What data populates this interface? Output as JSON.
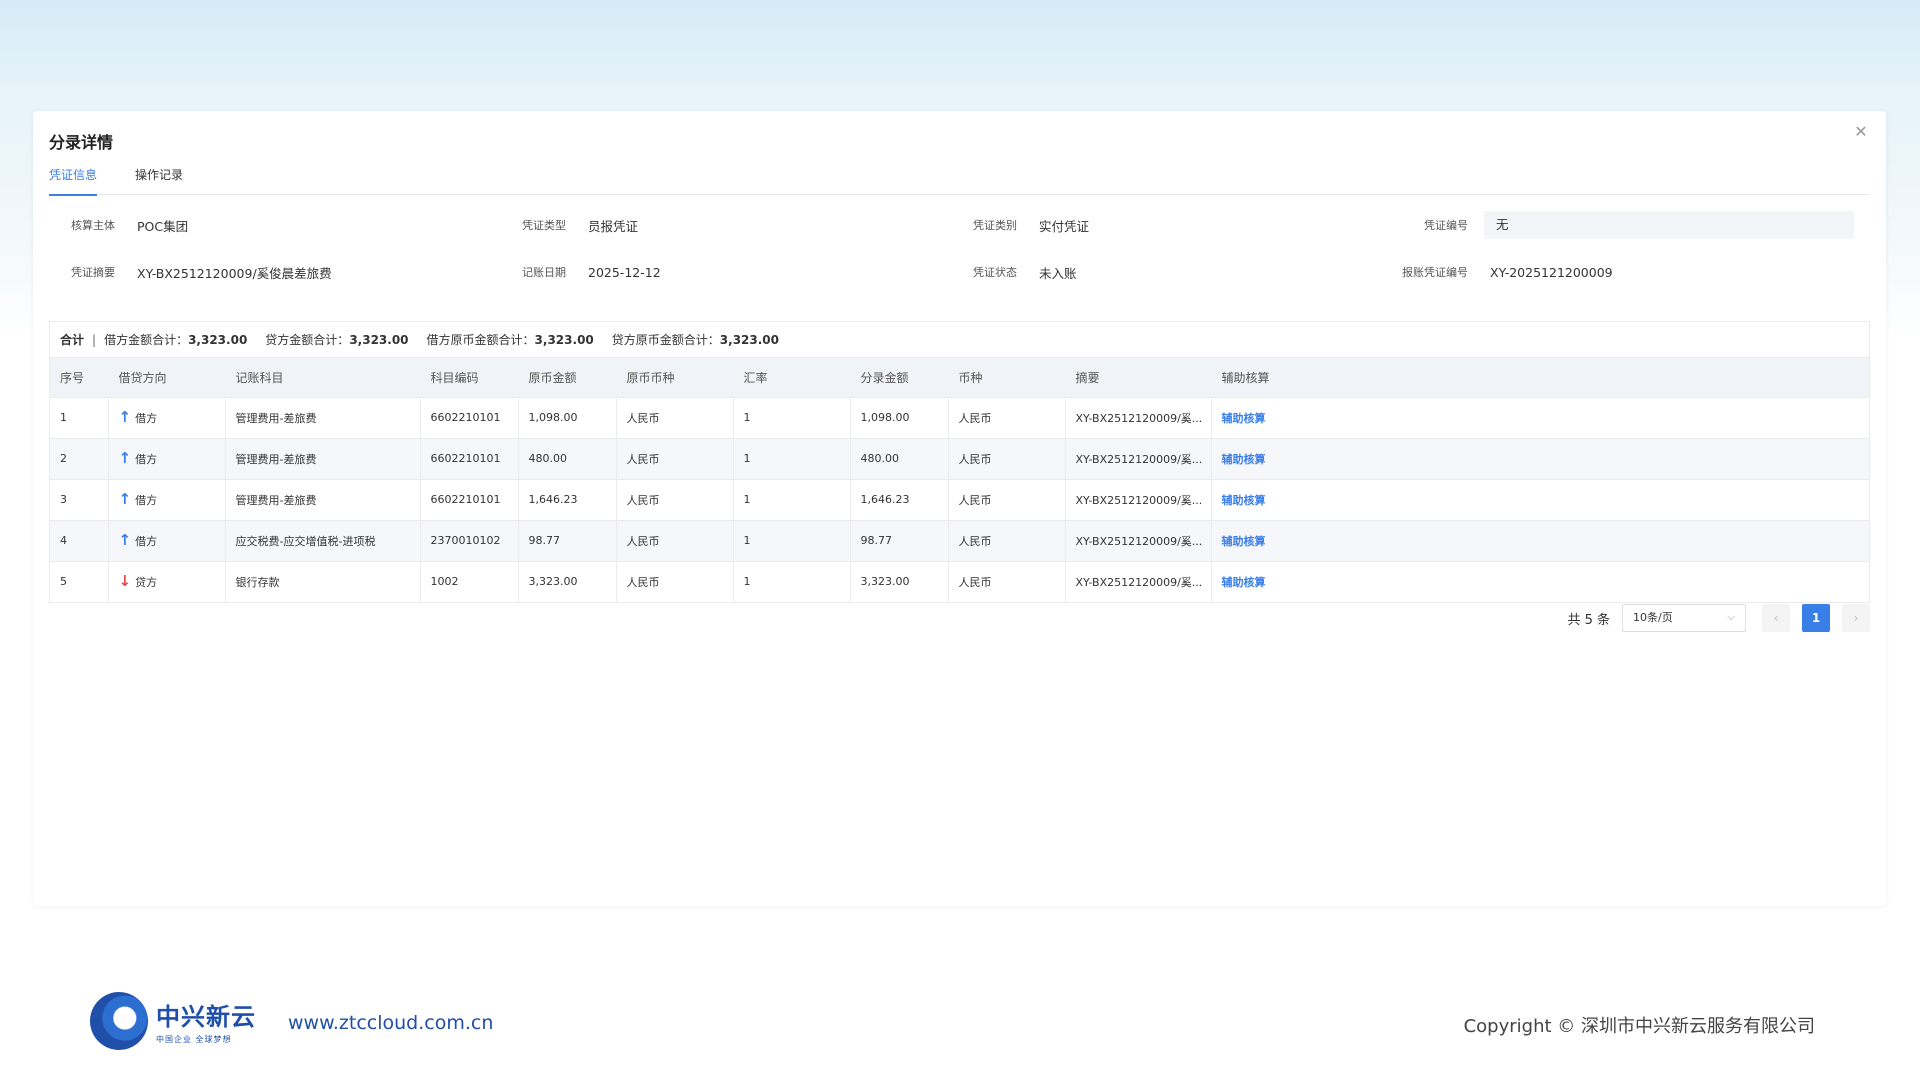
{
  "modal": {
    "title": "分录详情",
    "close_icon": "close-icon",
    "tabs": [
      {
        "label": "凭证信息",
        "active": true
      },
      {
        "label": "操作记录",
        "active": false
      }
    ]
  },
  "info": {
    "row1": [
      {
        "label": "核算主体",
        "value": "POC集团"
      },
      {
        "label": "凭证类型",
        "value": "员报凭证"
      },
      {
        "label": "凭证类别",
        "value": "实付凭证"
      },
      {
        "label": "凭证编号",
        "value": "无"
      }
    ],
    "row2": [
      {
        "label": "凭证摘要",
        "value": "XY-BX2512120009/奚俊晨差旅费"
      },
      {
        "label": "记账日期",
        "value": "2025-12-12"
      },
      {
        "label": "凭证状态",
        "value": "未入账"
      },
      {
        "label": "报账凭证编号",
        "value": "XY-2025121200009"
      }
    ]
  },
  "summary": {
    "label": "合计",
    "separator": "|",
    "items": [
      {
        "label": "借方金额合计：",
        "value": "3,323.00"
      },
      {
        "label": "贷方金额合计：",
        "value": "3,323.00"
      },
      {
        "label": "借方原币金额合计：",
        "value": "3,323.00"
      },
      {
        "label": "贷方原币金额合计：",
        "value": "3,323.00"
      }
    ]
  },
  "table": {
    "columns": [
      "序号",
      "借贷方向",
      "记账科目",
      "科目编码",
      "原币金额",
      "原币币种",
      "汇率",
      "分录金额",
      "币种",
      "摘要",
      "辅助核算"
    ],
    "rows": [
      {
        "no": "1",
        "direction": "借方",
        "dir_type": "up",
        "account": "管理费用-差旅费",
        "code": "6602210101",
        "orig_amount": "1,098.00",
        "orig_currency": "人民币",
        "rate": "1",
        "amount": "1,098.00",
        "currency": "人民币",
        "summary": "XY-BX2512120009/奚...",
        "aux": "辅助核算"
      },
      {
        "no": "2",
        "direction": "借方",
        "dir_type": "up",
        "account": "管理费用-差旅费",
        "code": "6602210101",
        "orig_amount": "480.00",
        "orig_currency": "人民币",
        "rate": "1",
        "amount": "480.00",
        "currency": "人民币",
        "summary": "XY-BX2512120009/奚...",
        "aux": "辅助核算"
      },
      {
        "no": "3",
        "direction": "借方",
        "dir_type": "up",
        "account": "管理费用-差旅费",
        "code": "6602210101",
        "orig_amount": "1,646.23",
        "orig_currency": "人民币",
        "rate": "1",
        "amount": "1,646.23",
        "currency": "人民币",
        "summary": "XY-BX2512120009/奚...",
        "aux": "辅助核算"
      },
      {
        "no": "4",
        "direction": "借方",
        "dir_type": "up",
        "account": "应交税费-应交增值税-进项税",
        "code": "2370010102",
        "orig_amount": "98.77",
        "orig_currency": "人民币",
        "rate": "1",
        "amount": "98.77",
        "currency": "人民币",
        "summary": "XY-BX2512120009/奚...",
        "aux": "辅助核算"
      },
      {
        "no": "5",
        "direction": "贷方",
        "dir_type": "down",
        "account": "银行存款",
        "code": "1002",
        "orig_amount": "3,323.00",
        "orig_currency": "人民币",
        "rate": "1",
        "amount": "3,323.00",
        "currency": "人民币",
        "summary": "XY-BX2512120009/奚...",
        "aux": "辅助核算"
      }
    ]
  },
  "pagination": {
    "total_text": "共 5 条",
    "page_size": "10条/页",
    "prev": "‹",
    "current_page": "1",
    "next": "›"
  },
  "watermark": {
    "text": "中兴新云"
  },
  "footer": {
    "logo_name": "中兴新云",
    "logo_slogan": "中国企业 全球梦想",
    "website": "www.ztccloud.com.cn",
    "copyright": "Copyright © 深圳市中兴新云服务有限公司"
  },
  "colors": {
    "accent": "#3a7ee8",
    "credit_arrow": "#e84a4a",
    "brand": "#1f4fa8"
  }
}
